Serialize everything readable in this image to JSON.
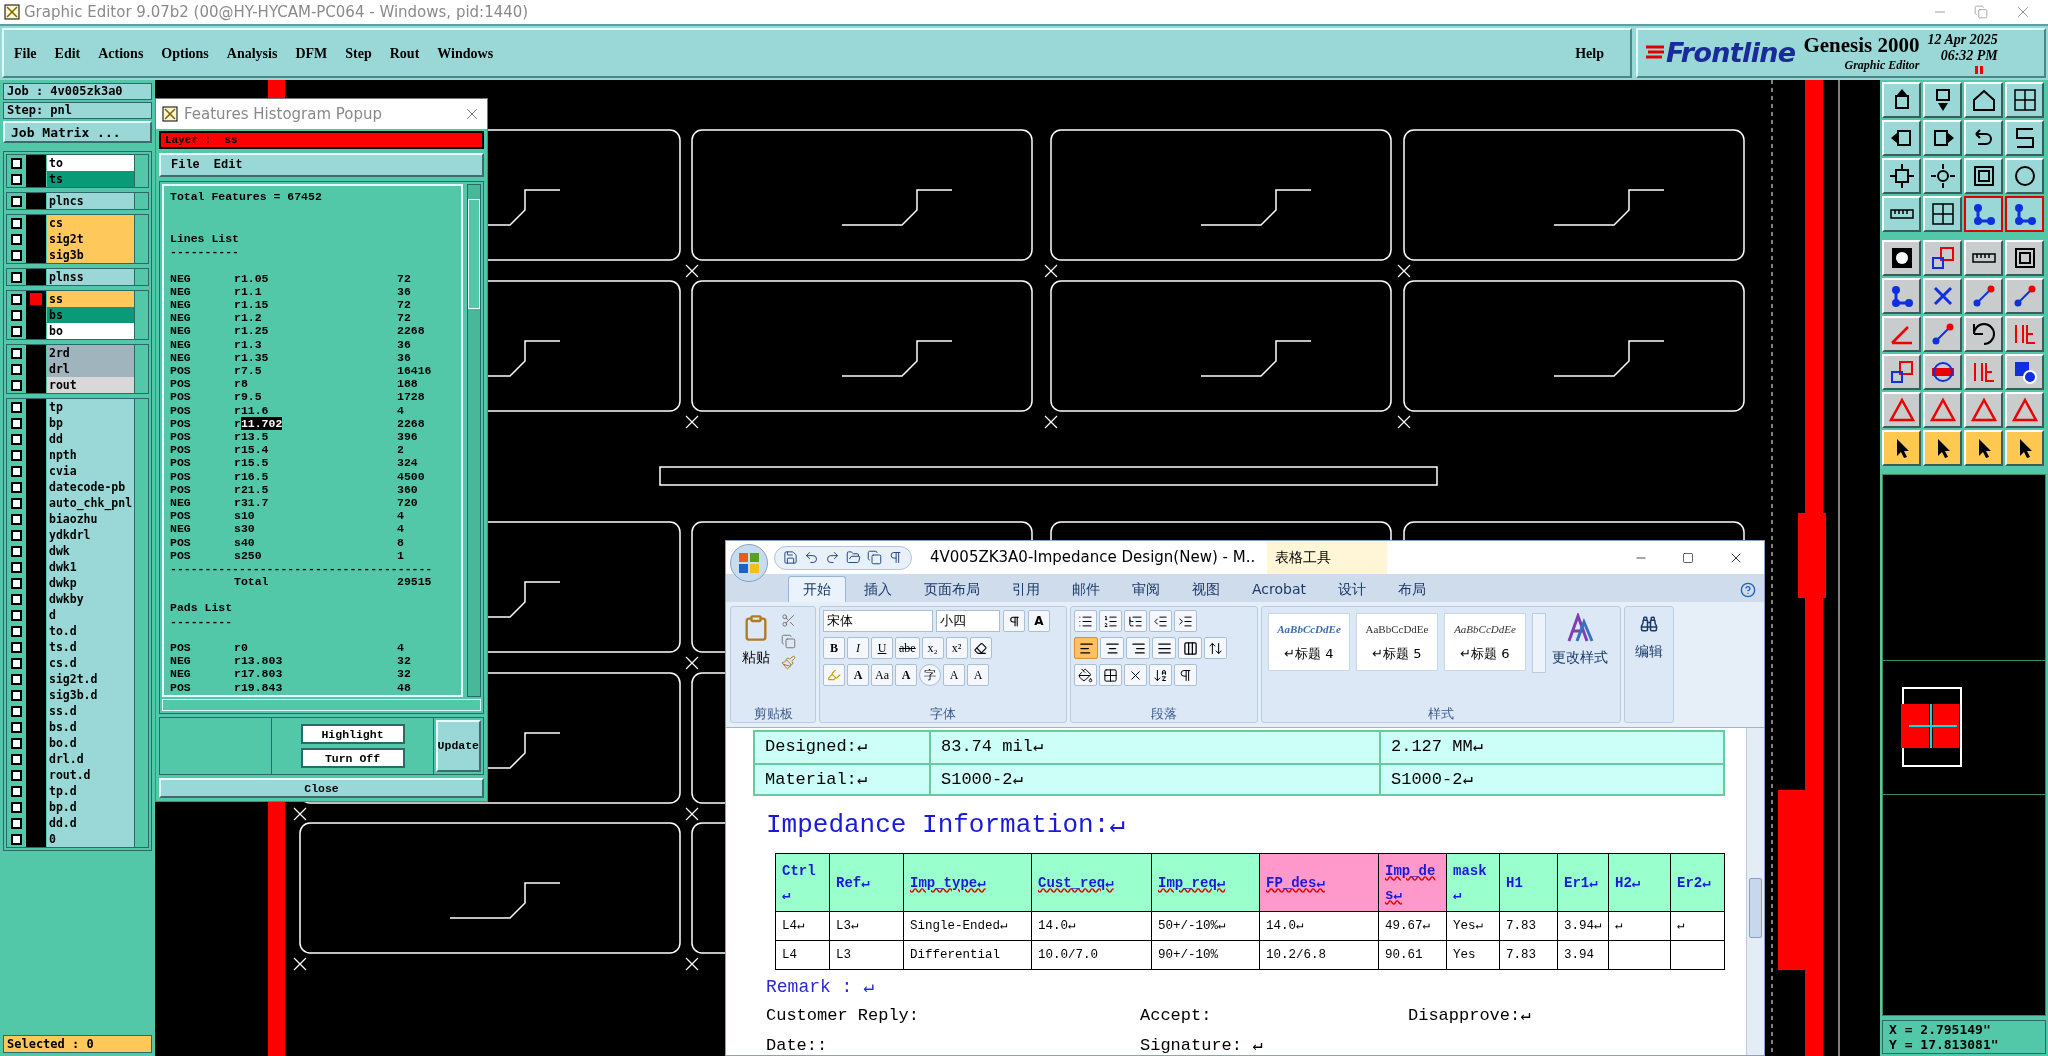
{
  "window": {
    "title": "Graphic Editor 9.07b2 (00@HY-HYCAM-PC064 - Windows, pid:1440)"
  },
  "menu": [
    "File",
    "Edit",
    "Actions",
    "Options",
    "Analysis",
    "DFM",
    "Step",
    "Rout",
    "Windows"
  ],
  "help": "Help",
  "brand": {
    "logo": "Frontline",
    "product": "Genesis 2000",
    "subtitle": "Graphic Editor",
    "date": "12 Apr 2025",
    "time": "06:32 PM"
  },
  "job": {
    "job": "Job : 4v005zk3a0",
    "step": "Step: pnl",
    "matrix_button": "Job Matrix ..."
  },
  "layer_groups": [
    {
      "layers": [
        {
          "name": "to",
          "color": "#ffffff",
          "checked": false,
          "work": false
        },
        {
          "name": "ts",
          "color": "#0a9a78",
          "checked": false,
          "work": false
        }
      ]
    },
    {
      "layers": [
        {
          "name": "plncs",
          "color": "#9ad8d8",
          "checked": false,
          "work": false
        }
      ]
    },
    {
      "layers": [
        {
          "name": "cs",
          "color": "#ffc85a",
          "checked": false,
          "work": false
        },
        {
          "name": "sig2t",
          "color": "#ffc85a",
          "checked": false,
          "work": false
        },
        {
          "name": "sig3b",
          "color": "#ffc85a",
          "checked": false,
          "work": false
        }
      ]
    },
    {
      "layers": [
        {
          "name": "plnss",
          "color": "#9ad8d8",
          "checked": false,
          "work": false
        }
      ]
    },
    {
      "layers": [
        {
          "name": "ss",
          "color": "#ffc85a",
          "checked": false,
          "work": true
        },
        {
          "name": "bs",
          "color": "#0a9a78",
          "checked": false,
          "work": false
        },
        {
          "name": "bo",
          "color": "#ffffff",
          "checked": false,
          "work": false
        }
      ]
    },
    {
      "layers": [
        {
          "name": "2rd",
          "color": "#9fb4bc",
          "checked": false,
          "work": false
        },
        {
          "name": "drl",
          "color": "#9fb4bc",
          "checked": false,
          "work": false
        },
        {
          "name": "rout",
          "color": "#d8d8d8",
          "checked": false,
          "work": false
        }
      ]
    },
    {
      "layers": [
        {
          "name": "tp",
          "color": "#9ad8d8",
          "checked": false,
          "work": false
        },
        {
          "name": "bp",
          "color": "#9ad8d8",
          "checked": false,
          "work": false
        },
        {
          "name": "dd",
          "color": "#9ad8d8",
          "checked": false,
          "work": false
        },
        {
          "name": "npth",
          "color": "#9ad8d8",
          "checked": false,
          "work": false
        },
        {
          "name": "cvia",
          "color": "#9ad8d8",
          "checked": false,
          "work": false
        },
        {
          "name": "datecode-pb",
          "color": "#9ad8d8",
          "checked": false,
          "work": false
        },
        {
          "name": "auto_chk_pnl",
          "color": "#9ad8d8",
          "checked": false,
          "work": false
        },
        {
          "name": "biaozhu",
          "color": "#9ad8d8",
          "checked": false,
          "work": false
        },
        {
          "name": "ydkdrl",
          "color": "#9ad8d8",
          "checked": false,
          "work": false
        },
        {
          "name": "dwk",
          "color": "#9ad8d8",
          "checked": false,
          "work": false
        },
        {
          "name": "dwk1",
          "color": "#9ad8d8",
          "checked": false,
          "work": false
        },
        {
          "name": "dwkp",
          "color": "#9ad8d8",
          "checked": false,
          "work": false
        },
        {
          "name": "dwkby",
          "color": "#9ad8d8",
          "checked": false,
          "work": false
        },
        {
          "name": "d",
          "color": "#9ad8d8",
          "checked": false,
          "work": false
        },
        {
          "name": "to.d",
          "color": "#9ad8d8",
          "checked": false,
          "work": false
        },
        {
          "name": "ts.d",
          "color": "#9ad8d8",
          "checked": false,
          "work": false
        },
        {
          "name": "cs.d",
          "color": "#9ad8d8",
          "checked": false,
          "work": false
        },
        {
          "name": "sig2t.d",
          "color": "#9ad8d8",
          "checked": false,
          "work": false
        },
        {
          "name": "sig3b.d",
          "color": "#9ad8d8",
          "checked": false,
          "work": false
        },
        {
          "name": "ss.d",
          "color": "#9ad8d8",
          "checked": false,
          "work": false
        },
        {
          "name": "bs.d",
          "color": "#9ad8d8",
          "checked": false,
          "work": false
        },
        {
          "name": "bo.d",
          "color": "#9ad8d8",
          "checked": false,
          "work": false
        },
        {
          "name": "drl.d",
          "color": "#9ad8d8",
          "checked": false,
          "work": false
        },
        {
          "name": "rout.d",
          "color": "#9ad8d8",
          "checked": false,
          "work": false
        },
        {
          "name": "tp.d",
          "color": "#9ad8d8",
          "checked": false,
          "work": false
        },
        {
          "name": "bp.d",
          "color": "#9ad8d8",
          "checked": false,
          "work": false
        },
        {
          "name": "dd.d",
          "color": "#9ad8d8",
          "checked": false,
          "work": false
        },
        {
          "name": "0",
          "color": "#9ad8d8",
          "checked": false,
          "work": false
        }
      ]
    }
  ],
  "selected": "Selected : 0",
  "popup": {
    "title": "Features Histogram Popup",
    "layer": "Layer :  ss",
    "menu": [
      "File",
      "Edit"
    ],
    "total": "Total Features = 67452",
    "sections": [
      {
        "title": "Lines List",
        "rule": "----------",
        "rows": [
          {
            "pol": "NEG",
            "sym": "r1.05",
            "count": "72"
          },
          {
            "pol": "NEG",
            "sym": "r1.1",
            "count": "36"
          },
          {
            "pol": "NEG",
            "sym": "r1.15",
            "count": "72"
          },
          {
            "pol": "NEG",
            "sym": "r1.2",
            "count": "72"
          },
          {
            "pol": "NEG",
            "sym": "r1.25",
            "count": "2268"
          },
          {
            "pol": "NEG",
            "sym": "r1.3",
            "count": "36"
          },
          {
            "pol": "NEG",
            "sym": "r1.35",
            "count": "36"
          },
          {
            "pol": "POS",
            "sym": "r7.5",
            "count": "16416"
          },
          {
            "pol": "POS",
            "sym": "r8",
            "count": "188"
          },
          {
            "pol": "POS",
            "sym": "r9.5",
            "count": "1728"
          },
          {
            "pol": "POS",
            "sym": "r11.6",
            "count": "4"
          },
          {
            "pol": "POS",
            "sym": "r",
            "sym_selected": "11.702",
            "count": "2268"
          },
          {
            "pol": "POS",
            "sym": "r13.5",
            "count": "396"
          },
          {
            "pol": "POS",
            "sym": "r15.4",
            "count": "2"
          },
          {
            "pol": "POS",
            "sym": "r15.5",
            "count": "324"
          },
          {
            "pol": "POS",
            "sym": "r16.5",
            "count": "4500"
          },
          {
            "pol": "POS",
            "sym": "r21.5",
            "count": "360"
          },
          {
            "pol": "NEG",
            "sym": "r31.7",
            "count": "720"
          },
          {
            "pol": "POS",
            "sym": "s10",
            "count": "4"
          },
          {
            "pol": "NEG",
            "sym": "s30",
            "count": "4"
          },
          {
            "pol": "POS",
            "sym": "s40",
            "count": "8"
          },
          {
            "pol": "POS",
            "sym": "s250",
            "count": "1"
          }
        ],
        "separator": "--------------------------------------",
        "total_label": "Total",
        "total": "29515"
      },
      {
        "title": "Pads List",
        "rule": "---------",
        "rows": [
          {
            "pol": "POS",
            "sym": "r0",
            "count": "4"
          },
          {
            "pol": "NEG",
            "sym": "r13.803",
            "count": "32"
          },
          {
            "pol": "NEG",
            "sym": "r17.803",
            "count": "32"
          },
          {
            "pol": "POS",
            "sym": "r19.843",
            "count": "48"
          }
        ]
      }
    ],
    "buttons": {
      "highlight": "Highlight",
      "turn_off": "Turn Off",
      "update": "Update",
      "close": "Close"
    }
  },
  "toolbar": [
    [
      {
        "on": false
      },
      {
        "on": false
      },
      {
        "on": false
      },
      {
        "on": false
      }
    ],
    [
      {
        "on": false
      },
      {
        "on": false
      },
      {
        "on": false
      },
      {
        "on": false
      }
    ],
    [
      {
        "on": false
      },
      {
        "on": false
      },
      {
        "on": false
      },
      {
        "on": false
      }
    ],
    [
      {
        "on": false
      },
      {
        "on": false
      },
      {
        "on": true
      },
      {
        "on": true
      }
    ],
    [
      {
        "on": false
      },
      {
        "on": false
      },
      {
        "on": false
      },
      {
        "on": false
      }
    ],
    [
      {
        "on": false
      },
      {
        "on": false
      },
      {
        "on": false
      },
      {
        "on": false
      }
    ],
    [
      {
        "on": false
      },
      {
        "on": false
      },
      {
        "on": false
      },
      {
        "on": false
      }
    ],
    [
      {
        "on": false
      },
      {
        "on": false
      },
      {
        "on": false
      },
      {
        "on": false
      }
    ],
    [
      {
        "on": false
      },
      {
        "on": false
      },
      {
        "on": false
      },
      {
        "on": false
      }
    ],
    [
      {
        "on": false
      },
      {
        "on": false
      },
      {
        "on": false
      },
      {
        "on": false
      }
    ]
  ],
  "coords": {
    "x": "X = 2.795149\"",
    "y": "Y = 17.813081\""
  },
  "word": {
    "title": "4V005ZK3A0-Impedance Design(New) - M..",
    "context_tab": "表格工具",
    "tabs": [
      {
        "label": "开始",
        "selected": true
      },
      {
        "label": "插入",
        "selected": false
      },
      {
        "label": "页面布局",
        "selected": false
      },
      {
        "label": "引用",
        "selected": false
      },
      {
        "label": "邮件",
        "selected": false
      },
      {
        "label": "审阅",
        "selected": false
      },
      {
        "label": "视图",
        "selected": false
      },
      {
        "label": "Acrobat",
        "selected": false
      },
      {
        "label": "设计",
        "selected": false
      },
      {
        "label": "布局",
        "selected": false
      }
    ],
    "clipboard": {
      "paste": "粘贴",
      "label": "剪贴板"
    },
    "font": {
      "face": "宋体",
      "size": "小四",
      "border_button": "A",
      "row1": [
        "B",
        "I",
        "U",
        "abe",
        "x₂",
        "x²"
      ],
      "row2": [
        "A",
        "Aa",
        "A",
        "字",
        "A",
        "A"
      ],
      "label": "字体"
    },
    "paragraph": {
      "align": [
        {
          "selected": true
        },
        {
          "selected": false
        },
        {
          "selected": false
        },
        {
          "selected": false
        },
        {
          "selected": false
        }
      ],
      "label": "段落"
    },
    "styles": {
      "items": [
        {
          "sample": "AaBbCcDdEe",
          "name": "↵标题 4",
          "kind": "bold-italic"
        },
        {
          "sample": "AaBbCcDdEe",
          "name": "↵标题 5",
          "kind": "regular"
        },
        {
          "sample": "AaBbCcDdEe",
          "name": "↵标题 6",
          "kind": "italic"
        }
      ],
      "change": "更改样式",
      "label": "样式"
    },
    "editing": "编辑",
    "spec_rows": [
      [
        "Designed:↵",
        "83.74 mil↵",
        "2.127 MM↵"
      ],
      [
        "Material:↵",
        "S1000-2↵",
        "S1000-2↵"
      ]
    ],
    "heading": "Impedance Information:↵",
    "imp_columns": [
      {
        "label": "Ctrl↵",
        "color": "#99ffcc",
        "misspelled": false
      },
      {
        "label": "Ref↵",
        "color": "#99ffcc",
        "misspelled": false
      },
      {
        "label": "Imp_type↵",
        "color": "#99ffcc",
        "misspelled": true
      },
      {
        "label": "Cust_req↵",
        "color": "#99ffcc",
        "misspelled": true
      },
      {
        "label": "Imp_req↵",
        "color": "#99ffcc",
        "misspelled": true
      },
      {
        "label": "FP_des↵",
        "color": "#ff99cc",
        "misspelled": true
      },
      {
        "label": "Imp_des↵",
        "color": "#ff99cc",
        "misspelled": true
      },
      {
        "label": "mask↵",
        "color": "#99ffcc",
        "misspelled": false
      },
      {
        "label": "H1",
        "color": "#99ffcc",
        "misspelled": false
      },
      {
        "label": "Er1↵",
        "color": "#99ffcc",
        "misspelled": false
      },
      {
        "label": "H2↵",
        "color": "#99ffcc",
        "misspelled": false
      },
      {
        "label": "Er2↵",
        "color": "#99ffcc",
        "misspelled": false
      }
    ],
    "imp_rows": [
      [
        "L4↵",
        "L3↵",
        "Single-Ended↵",
        "14.0↵",
        "50+/-10%↵",
        "14.0↵",
        "49.67↵",
        "Yes↵",
        "7.83",
        "3.94↵",
        "↵",
        "↵"
      ],
      [
        "L4",
        "L3",
        "Differential",
        "10.0/7.0",
        "90+/-10%",
        "10.2/6.8",
        "90.61",
        "Yes",
        "7.83",
        "3.94",
        null,
        null
      ]
    ],
    "remark": "Remark : ↵",
    "customer_reply": "Customer Reply:",
    "accept": "Accept:",
    "disapprove": "Disapprove:↵",
    "date": "Date::",
    "signature": "Signature: ↵"
  }
}
